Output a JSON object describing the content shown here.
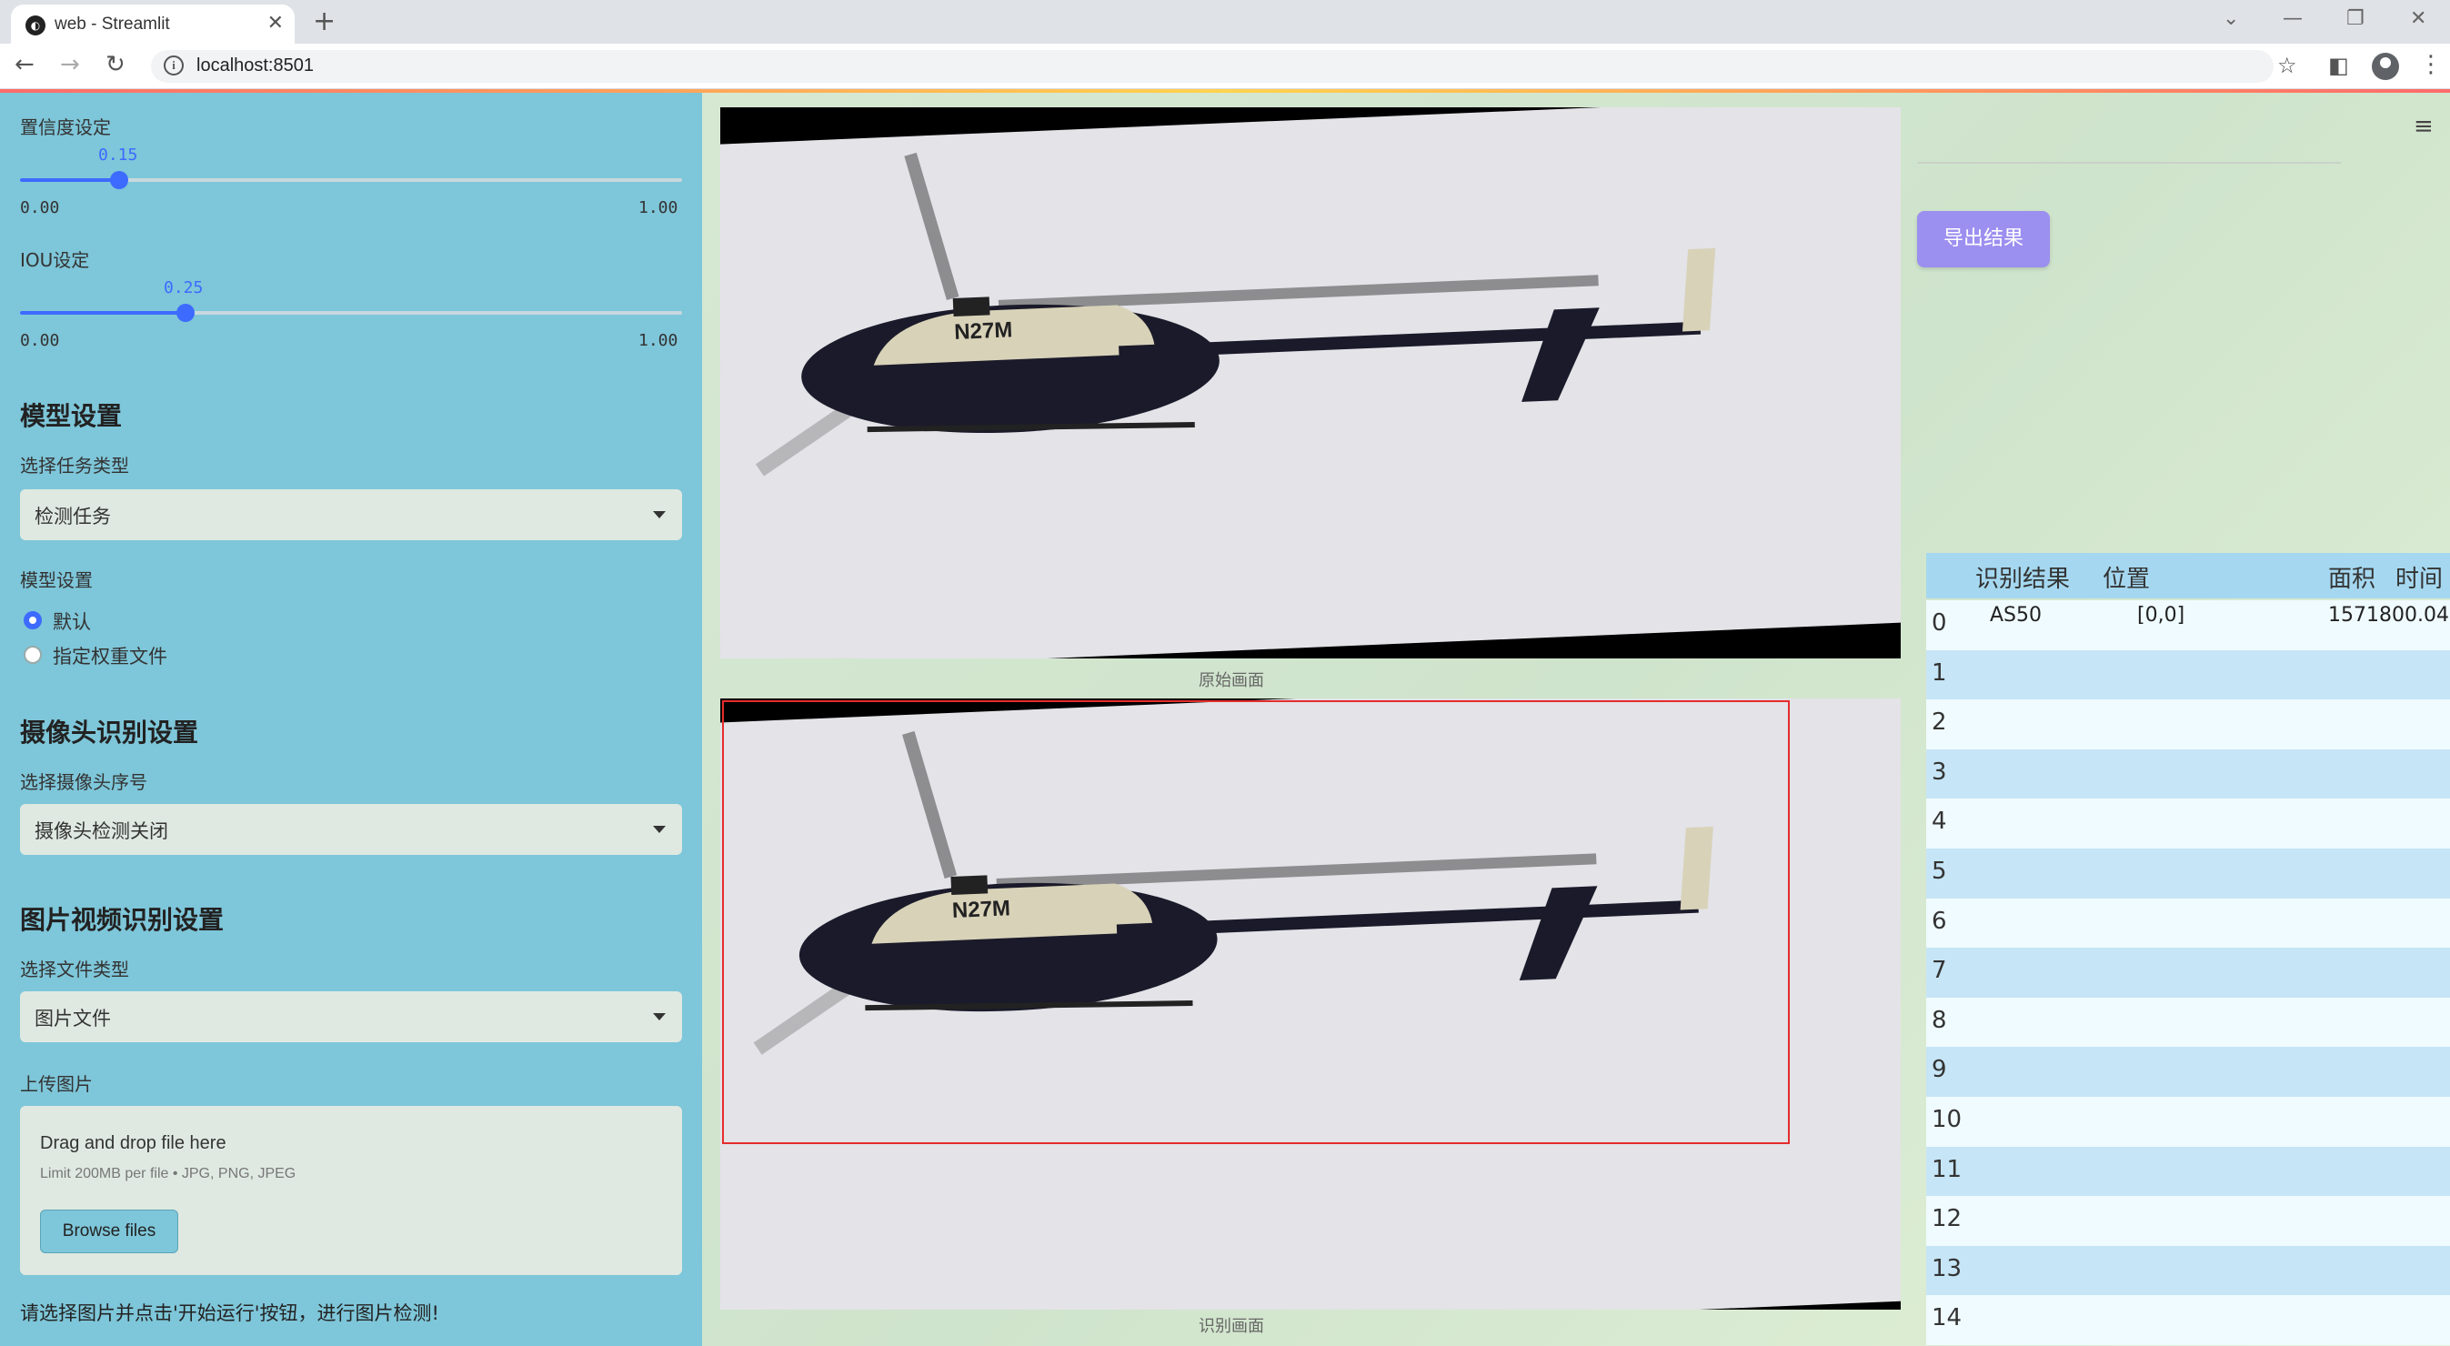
{
  "browser": {
    "tab_title": "web - Streamlit",
    "url": "localhost:8501"
  },
  "sidebar": {
    "confidence": {
      "label": "置信度设定",
      "value": "0.15",
      "min": "0.00",
      "max": "1.00",
      "fraction": 0.15
    },
    "iou": {
      "label": "IOU设定",
      "value": "0.25",
      "min": "0.00",
      "max": "1.00",
      "fraction": 0.25
    },
    "model_section": {
      "heading": "模型设置",
      "task_label": "选择任务类型",
      "task_value": "检测任务",
      "model_label": "模型设置",
      "options": [
        "默认",
        "指定权重文件"
      ],
      "selected_index": 0
    },
    "camera_section": {
      "heading": "摄像头识别设置",
      "label": "选择摄像头序号",
      "value": "摄像头检测关闭"
    },
    "media_section": {
      "heading": "图片视频识别设置",
      "file_type_label": "选择文件类型",
      "file_type_value": "图片文件",
      "upload_label": "上传图片",
      "drop_text": "Drag and drop file here",
      "limit_text": "Limit 200MB per file • JPG, PNG, JPEG",
      "browse_label": "Browse files"
    },
    "hint": "请选择图片并点击'开始运行'按钮，进行图片检测!"
  },
  "main": {
    "original_caption": "原始画面",
    "result_caption": "识别画面",
    "aircraft_marking": "N27M",
    "export_label": "导出结果"
  },
  "table": {
    "headers": [
      "识别结果",
      "位置",
      "面积",
      "时间"
    ],
    "rows": [
      {
        "index": "0",
        "result": "AS50",
        "position": "[0,0]",
        "area": "1571800.04"
      },
      {
        "index": "1"
      },
      {
        "index": "2"
      },
      {
        "index": "3"
      },
      {
        "index": "4"
      },
      {
        "index": "5"
      },
      {
        "index": "6"
      },
      {
        "index": "7"
      },
      {
        "index": "8"
      },
      {
        "index": "9"
      },
      {
        "index": "10"
      },
      {
        "index": "11"
      },
      {
        "index": "12"
      },
      {
        "index": "13"
      },
      {
        "index": "14"
      }
    ]
  }
}
